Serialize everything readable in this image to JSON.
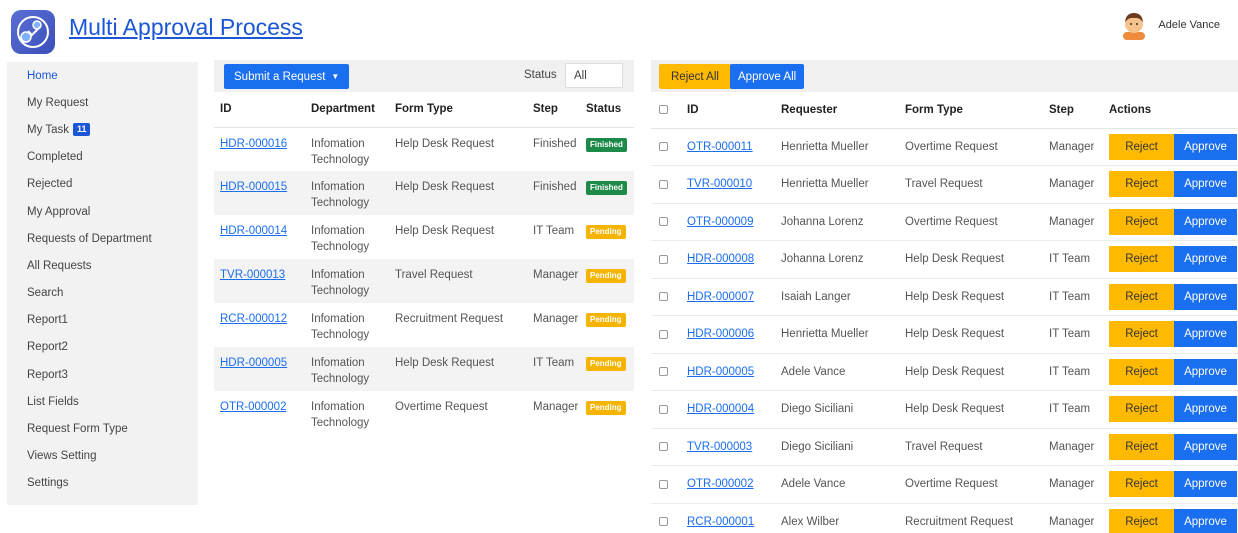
{
  "app": {
    "title": "Multi Approval Process"
  },
  "user": {
    "name": "Adele Vance"
  },
  "sidebar": {
    "items": [
      {
        "label": "Home"
      },
      {
        "label": "My Request"
      },
      {
        "label": "My Task",
        "badge": "11"
      },
      {
        "label": "Completed"
      },
      {
        "label": "Rejected"
      },
      {
        "label": "My Approval"
      },
      {
        "label": "Requests of Department"
      },
      {
        "label": "All Requests"
      },
      {
        "label": "Search"
      },
      {
        "label": "Report1"
      },
      {
        "label": "Report2"
      },
      {
        "label": "Report3"
      },
      {
        "label": "List Fields"
      },
      {
        "label": "Request Form Type"
      },
      {
        "label": "Views Setting"
      },
      {
        "label": "Settings"
      }
    ]
  },
  "requests": {
    "submit_label": "Submit a Request",
    "status_label": "Status",
    "status_value": "All",
    "columns": [
      "ID",
      "Department",
      "Form Type",
      "Step",
      "Status"
    ],
    "rows": [
      {
        "id": "HDR-000016",
        "dept1": "Infomation",
        "dept2": "Technology",
        "form": "Help Desk Request",
        "step": "Finished",
        "status": "Finished"
      },
      {
        "id": "HDR-000015",
        "dept1": "Infomation",
        "dept2": "Technology",
        "form": "Help Desk Request",
        "step": "Finished",
        "status": "Finished"
      },
      {
        "id": "HDR-000014",
        "dept1": "Infomation",
        "dept2": "Technology",
        "form": "Help Desk Request",
        "step": "IT Team",
        "status": "Pending"
      },
      {
        "id": "TVR-000013",
        "dept1": "Infomation",
        "dept2": "Technology",
        "form": "Travel Request",
        "step": "Manager",
        "status": "Pending"
      },
      {
        "id": "RCR-000012",
        "dept1": "Infomation",
        "dept2": "Technology",
        "form": "Recruitment Request",
        "step": "Manager",
        "status": "Pending"
      },
      {
        "id": "HDR-000005",
        "dept1": "Infomation",
        "dept2": "Technology",
        "form": "Help Desk Request",
        "step": "IT Team",
        "status": "Pending"
      },
      {
        "id": "OTR-000002",
        "dept1": "Infomation",
        "dept2": "Technology",
        "form": "Overtime Request",
        "step": "Manager",
        "status": "Pending"
      }
    ]
  },
  "approvals": {
    "reject_all_label": "Reject All",
    "approve_all_label": "Approve All",
    "reject_label": "Reject",
    "approve_label": "Approve",
    "columns": [
      "ID",
      "Requester",
      "Form Type",
      "Step",
      "Actions"
    ],
    "rows": [
      {
        "id": "OTR-000011",
        "requester": "Henrietta Mueller",
        "form": "Overtime Request",
        "step": "Manager"
      },
      {
        "id": "TVR-000010",
        "requester": "Henrietta Mueller",
        "form": "Travel Request",
        "step": "Manager"
      },
      {
        "id": "OTR-000009",
        "requester": "Johanna Lorenz",
        "form": "Overtime Request",
        "step": "Manager"
      },
      {
        "id": "HDR-000008",
        "requester": "Johanna Lorenz",
        "form": "Help Desk Request",
        "step": "IT Team"
      },
      {
        "id": "HDR-000007",
        "requester": "Isaiah Langer",
        "form": "Help Desk Request",
        "step": "IT Team"
      },
      {
        "id": "HDR-000006",
        "requester": "Henrietta Mueller",
        "form": "Help Desk Request",
        "step": "IT Team"
      },
      {
        "id": "HDR-000005",
        "requester": "Adele Vance",
        "form": "Help Desk Request",
        "step": "IT Team"
      },
      {
        "id": "HDR-000004",
        "requester": "Diego Siciliani",
        "form": "Help Desk Request",
        "step": "IT Team"
      },
      {
        "id": "TVR-000003",
        "requester": "Diego Siciliani",
        "form": "Travel Request",
        "step": "Manager"
      },
      {
        "id": "OTR-000002",
        "requester": "Adele Vance",
        "form": "Overtime Request",
        "step": "Manager"
      },
      {
        "id": "RCR-000001",
        "requester": "Alex Wilber",
        "form": "Recruitment Request",
        "step": "Manager"
      }
    ]
  },
  "colors": {
    "primary": "#1a6ef0",
    "warning": "#ffb900",
    "finished": "#1e8a4a",
    "pending": "#f5b400"
  }
}
